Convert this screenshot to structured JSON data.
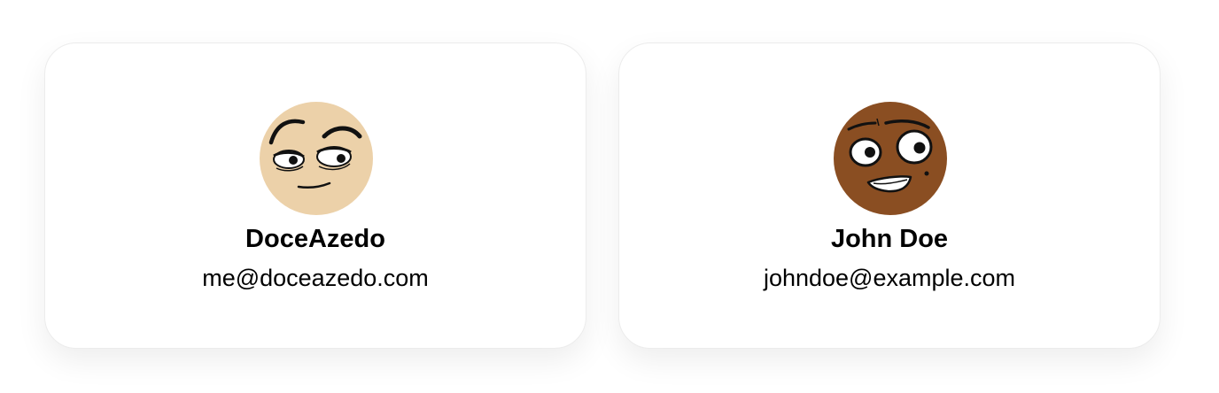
{
  "users": [
    {
      "name": "DoceAzedo",
      "email": "me@doceazedo.com",
      "avatar_icon": "sleepy-face-avatar-icon",
      "skin_color": "#ecd1a9"
    },
    {
      "name": "John Doe",
      "email": "johndoe@example.com",
      "avatar_icon": "nervous-face-avatar-icon",
      "skin_color": "#8a4e22"
    }
  ]
}
